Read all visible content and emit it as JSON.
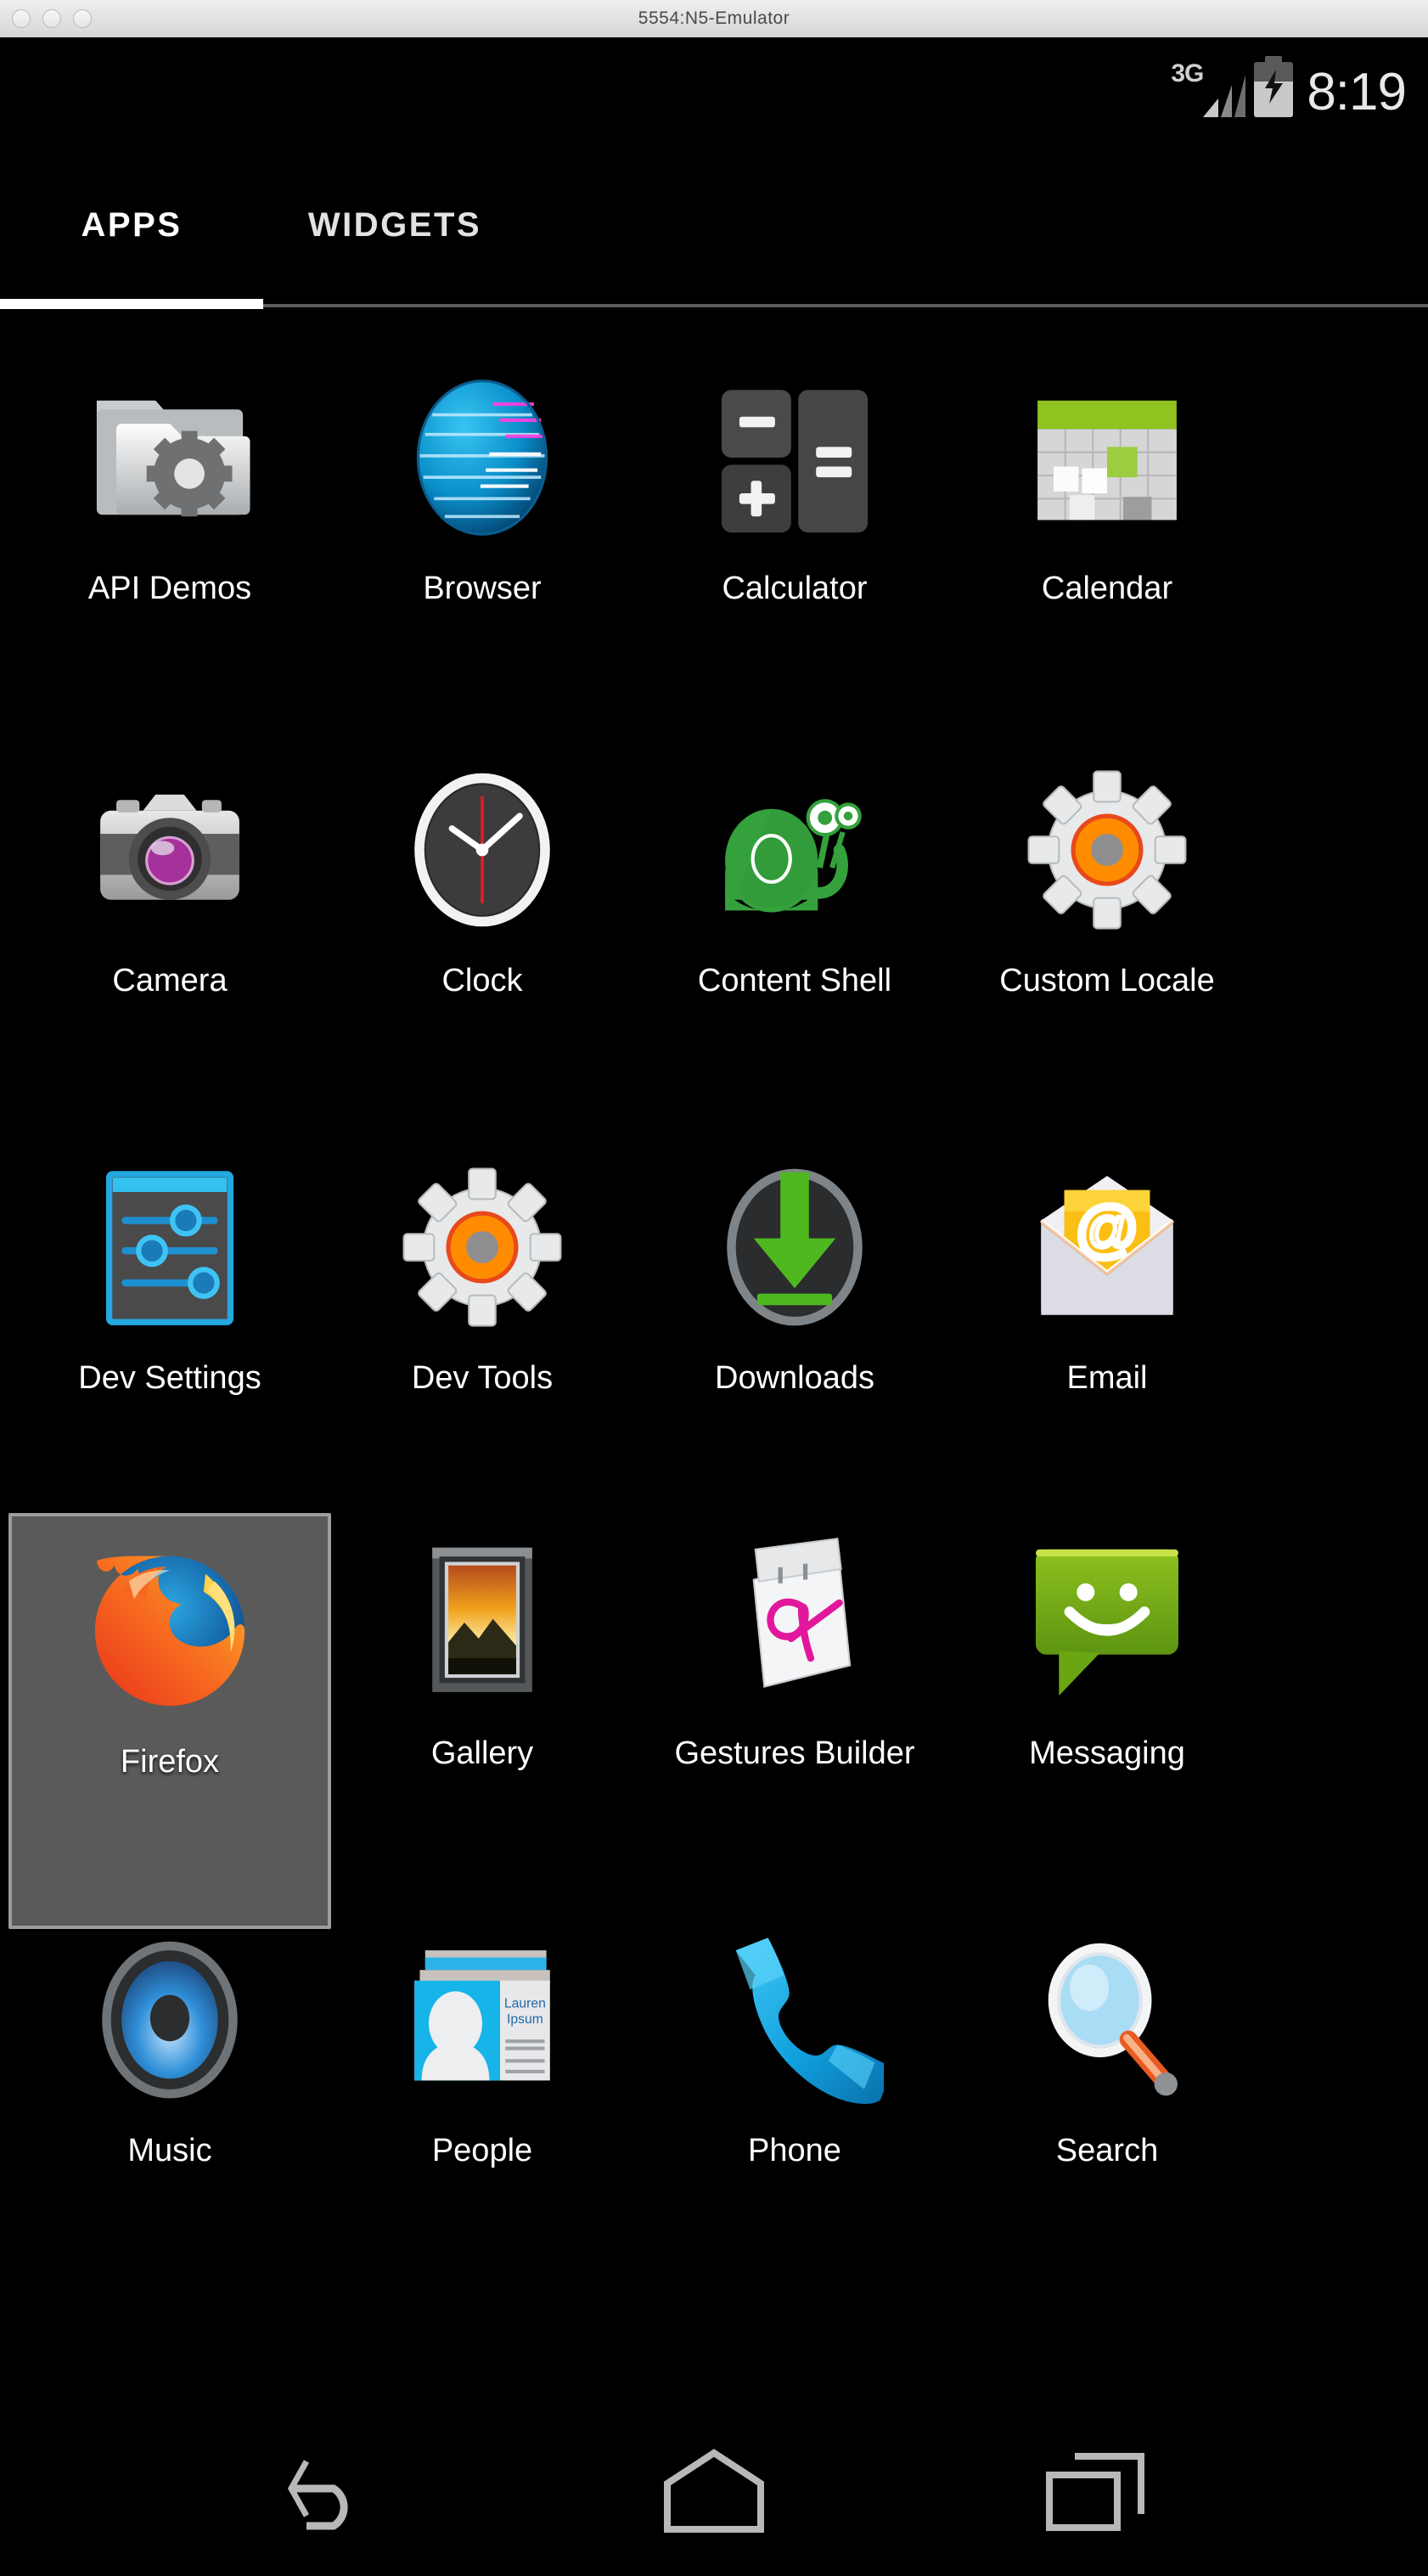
{
  "window": {
    "title": "5554:N5-Emulator",
    "buttons": [
      "close",
      "minimize",
      "zoom"
    ]
  },
  "status_bar": {
    "network_label": "3G",
    "signal_icon": "signal-bars-icon",
    "battery_icon": "battery-charging-icon",
    "time": "8:19"
  },
  "tabs": [
    {
      "label": "APPS",
      "active": true
    },
    {
      "label": "WIDGETS",
      "active": false
    }
  ],
  "app_drawer": {
    "columns": 4,
    "selected_app": "Firefox",
    "apps": [
      {
        "label": "API Demos",
        "icon": "folder-gear-icon",
        "selected": false
      },
      {
        "label": "Browser",
        "icon": "globe-icon",
        "selected": false
      },
      {
        "label": "Calculator",
        "icon": "calculator-keys-icon",
        "selected": false
      },
      {
        "label": "Calendar",
        "icon": "calendar-grid-icon",
        "selected": false
      },
      {
        "label": "Camera",
        "icon": "camera-icon",
        "selected": false
      },
      {
        "label": "Clock",
        "icon": "analog-clock-icon",
        "selected": false
      },
      {
        "label": "Content Shell",
        "icon": "green-snail-icon",
        "selected": false
      },
      {
        "label": "Custom Locale",
        "icon": "gear-orange-icon",
        "selected": false
      },
      {
        "label": "Dev Settings",
        "icon": "sliders-panel-icon",
        "selected": false
      },
      {
        "label": "Dev Tools",
        "icon": "gear-orange-icon",
        "selected": false
      },
      {
        "label": "Downloads",
        "icon": "download-arrow-icon",
        "selected": false
      },
      {
        "label": "Email",
        "icon": "envelope-at-icon",
        "selected": false
      },
      {
        "label": "Firefox",
        "icon": "firefox-icon",
        "selected": true
      },
      {
        "label": "Gallery",
        "icon": "framed-photo-icon",
        "selected": false
      },
      {
        "label": "Gestures Builder",
        "icon": "notepad-gesture-icon",
        "selected": false
      },
      {
        "label": "Messaging",
        "icon": "speech-bubble-smile-icon",
        "selected": false
      },
      {
        "label": "Music",
        "icon": "speaker-icon",
        "selected": false
      },
      {
        "label": "People",
        "icon": "contact-card-icon",
        "selected": false
      },
      {
        "label": "Phone",
        "icon": "phone-handset-icon",
        "selected": false
      },
      {
        "label": "Search",
        "icon": "magnifier-icon",
        "selected": false
      }
    ],
    "people_card_text": [
      "Lauren",
      "Ipsum"
    ]
  },
  "nav_bar": [
    {
      "name": "back",
      "icon": "back-arrow-icon"
    },
    {
      "name": "home",
      "icon": "home-icon"
    },
    {
      "name": "recents",
      "icon": "recents-icon"
    }
  ],
  "colors": {
    "background": "#000000",
    "selected_cell": "#5a5a5a",
    "selected_border": "#9d9d9d",
    "tab_active_underline": "#ffffff",
    "status_text": "#e8e8e8",
    "android_green": "#8fc31f",
    "firefox_orange": "#f26522",
    "accent_blue": "#33b5e5"
  }
}
